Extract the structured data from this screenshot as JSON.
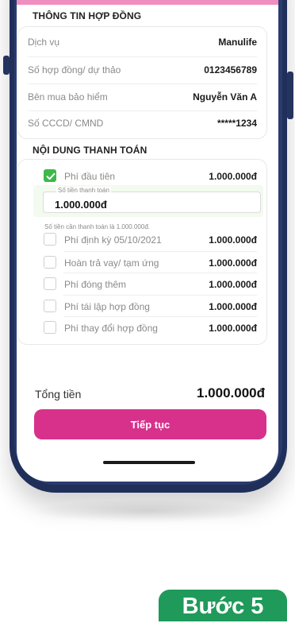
{
  "contract_info": {
    "title": "THÔNG TIN HỢP ĐỒNG",
    "rows": [
      {
        "label": "Dịch vụ",
        "value": "Manulife"
      },
      {
        "label": "Số hợp đồng/ dự thảo",
        "value": "0123456789"
      },
      {
        "label": "Bên mua bảo hiểm",
        "value": "Nguyễn Văn A"
      },
      {
        "label": "Số CCCD/ CMND",
        "value": "*****1234"
      }
    ]
  },
  "payment": {
    "title": "NỘI DUNG THANH TOÁN",
    "first_fee": {
      "label": "Phí đầu tiên",
      "value": "1.000.000đ",
      "checked": true
    },
    "amount_field": {
      "legend": "Số tiền thanh toán",
      "value": "1.000.000đ"
    },
    "hint": "Số tiền cần thanh toán là 1.000.000đ.",
    "items": [
      {
        "label": "Phí định kỳ 05/10/2021",
        "value": "1.000.000đ",
        "checked": false
      },
      {
        "label": "Hoàn trả vay/ tạm ứng",
        "value": "1.000.000đ",
        "checked": false
      },
      {
        "label": "Phí đóng thêm",
        "value": "1.000.000đ",
        "checked": false
      },
      {
        "label": "Phí tái lập hợp đồng",
        "value": "1.000.000đ",
        "checked": false
      },
      {
        "label": "Phí thay đổi hợp đồng",
        "value": "1.000.000đ",
        "checked": false
      }
    ]
  },
  "total": {
    "label": "Tổng tiền",
    "value": "1.000.000đ"
  },
  "continue_button": "Tiếp tục",
  "step_badge": "Bước 5",
  "colors": {
    "accent": "#d8318c",
    "check": "#3db84a",
    "badge": "#1f9a5a",
    "phone_frame": "#1f2f5a"
  }
}
